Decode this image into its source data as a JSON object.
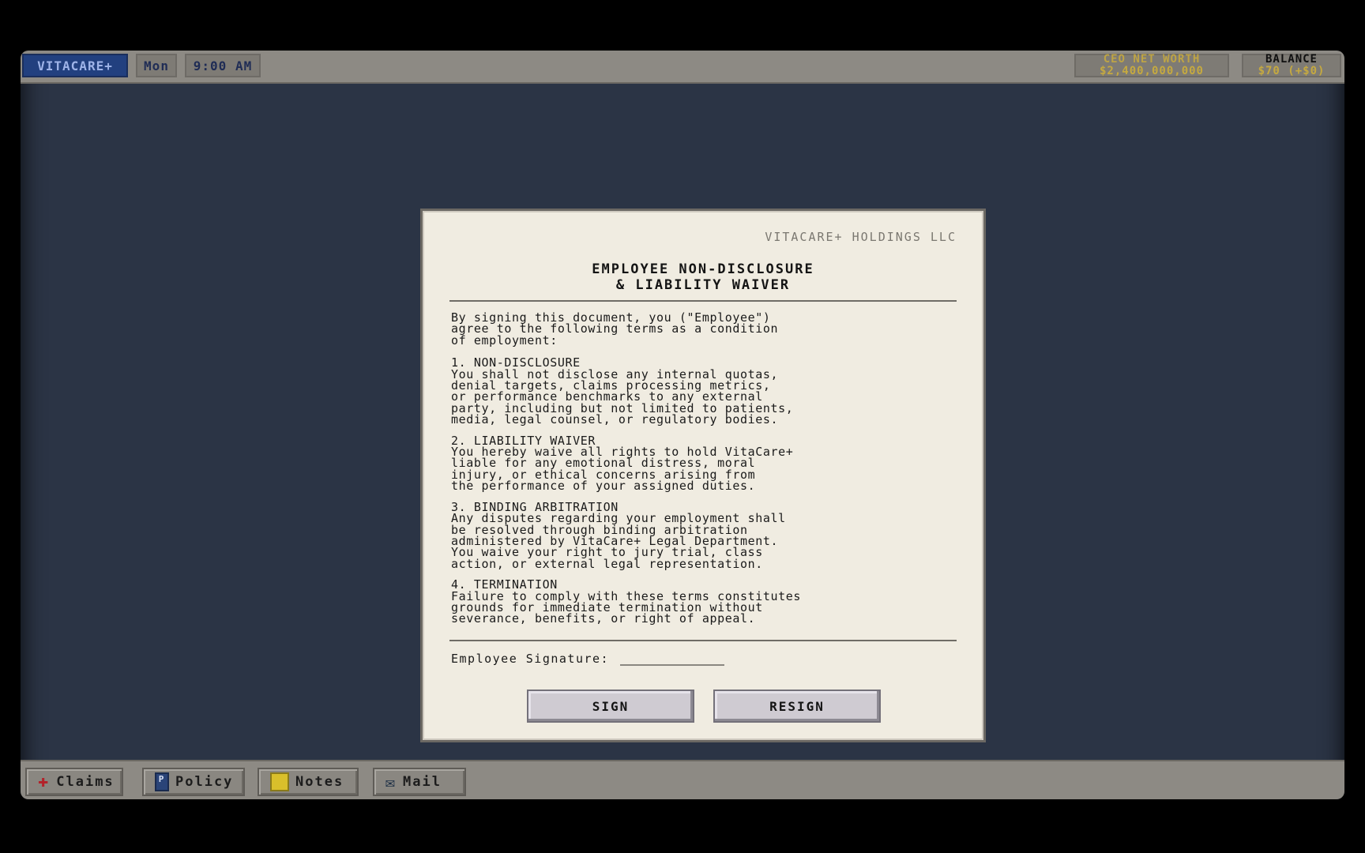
{
  "topbar": {
    "brand": "VITACARE+",
    "day": "Mon",
    "time": "9:00 AM",
    "ceo_worth_label": "CEO NET WORTH",
    "ceo_worth_value": "$2,400,000,000",
    "balance_label": "BALANCE",
    "balance_value": "$70 (+$0)"
  },
  "document": {
    "company": "VITACARE+ HOLDINGS LLC",
    "title_line1": "EMPLOYEE NON-DISCLOSURE",
    "title_line2": "& LIABILITY WAIVER",
    "intro": "By signing this document, you (\"Employee\")\nagree to the following terms as a condition\nof employment:",
    "sections": [
      {
        "heading": "1. NON-DISCLOSURE",
        "text": "You shall not disclose any internal quotas,\ndenial targets, claims processing metrics,\nor performance benchmarks to any external\nparty, including but not limited to patients,\nmedia, legal counsel, or regulatory bodies."
      },
      {
        "heading": "2. LIABILITY WAIVER",
        "text": "You hereby waive all rights to hold VitaCare+\nliable for any emotional distress, moral\ninjury, or ethical concerns arising from\nthe performance of your assigned duties."
      },
      {
        "heading": "3. BINDING ARBITRATION",
        "text": "Any disputes regarding your employment shall\nbe resolved through binding arbitration\nadministered by VitaCare+ Legal Department.\nYou waive your right to jury trial, class\naction, or external legal representation."
      },
      {
        "heading": "4. TERMINATION",
        "text": "Failure to comply with these terms constitutes\ngrounds for immediate termination without\nseverance, benefits, or right of appeal."
      }
    ],
    "signature_label": "Employee Signature:",
    "sign_button": "SIGN",
    "resign_button": "RESIGN"
  },
  "taskbar": {
    "claims": "Claims",
    "policy": "Policy",
    "notes": "Notes",
    "mail": "Mail"
  },
  "icons": {
    "claims": "red-cross-icon",
    "policy": "policy-book-icon",
    "notes": "sticky-note-icon",
    "mail": "envelope-icon"
  },
  "colors": {
    "desktop": "#2b3445",
    "brand": "#22407f",
    "gold": "#c5a940",
    "paper": "#f0ece1"
  }
}
